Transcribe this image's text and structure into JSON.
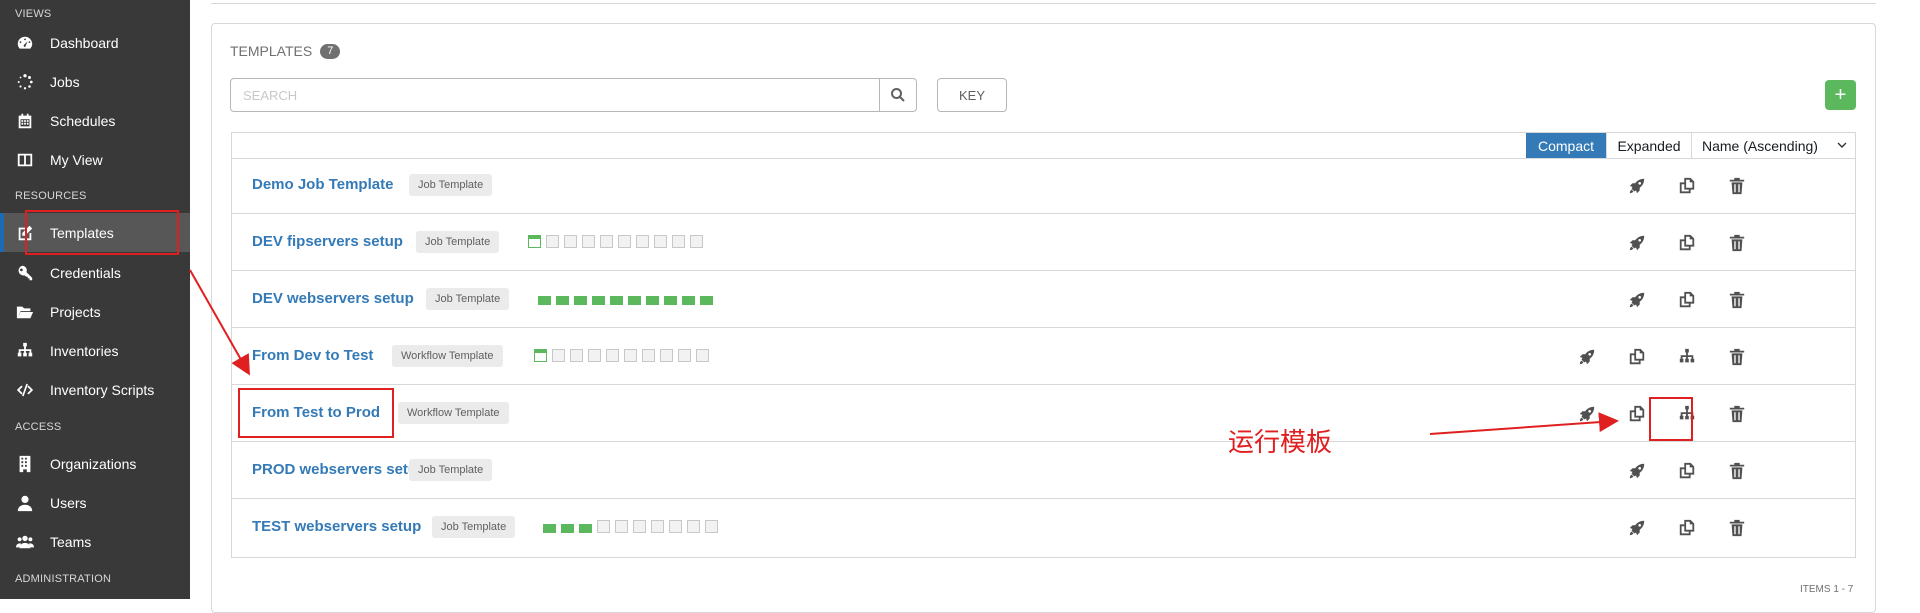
{
  "sidebar": {
    "sections": {
      "views": "VIEWS",
      "resources": "RESOURCES",
      "access": "ACCESS",
      "administration": "ADMINISTRATION"
    },
    "items": [
      {
        "label": "Dashboard",
        "icon": "dashboard-icon"
      },
      {
        "label": "Jobs",
        "icon": "spinner-icon"
      },
      {
        "label": "Schedules",
        "icon": "calendar-icon"
      },
      {
        "label": "My View",
        "icon": "columns-icon"
      },
      {
        "label": "Templates",
        "icon": "edit-icon",
        "active": true
      },
      {
        "label": "Credentials",
        "icon": "key-icon"
      },
      {
        "label": "Projects",
        "icon": "folder-open-icon"
      },
      {
        "label": "Inventories",
        "icon": "sitemap-icon"
      },
      {
        "label": "Inventory Scripts",
        "icon": "code-icon"
      },
      {
        "label": "Organizations",
        "icon": "building-icon"
      },
      {
        "label": "Users",
        "icon": "user-icon"
      },
      {
        "label": "Teams",
        "icon": "users-icon"
      }
    ]
  },
  "header": {
    "title": "TEMPLATES",
    "count": "7"
  },
  "search": {
    "placeholder": "SEARCH"
  },
  "key_label": "KEY",
  "add_label": "+",
  "view_toggle": {
    "compact": "Compact",
    "expanded": "Expanded",
    "sort": "Name (Ascending)"
  },
  "rows": [
    {
      "name": "Demo Job Template",
      "type": "Job Template",
      "sparkline": [],
      "actions": [
        "launch",
        "copy",
        "delete"
      ]
    },
    {
      "name": "DEV fipservers setup",
      "type": "Job Template",
      "sparkline": [
        "ok",
        "empty",
        "empty",
        "empty",
        "empty",
        "empty",
        "empty",
        "empty",
        "empty",
        "empty"
      ],
      "actions": [
        "launch",
        "copy",
        "delete"
      ]
    },
    {
      "name": "DEV webservers setup",
      "type": "Job Template",
      "sparkline": [
        "ok",
        "ok",
        "ok",
        "ok",
        "ok",
        "ok",
        "ok",
        "ok",
        "ok",
        "ok"
      ],
      "actions": [
        "launch",
        "copy",
        "delete"
      ]
    },
    {
      "name": "From Dev to Test",
      "type": "Workflow Template",
      "sparkline": [
        "ok",
        "empty",
        "empty",
        "empty",
        "empty",
        "empty",
        "empty",
        "empty",
        "empty",
        "empty"
      ],
      "actions": [
        "launch",
        "copy",
        "visualize",
        "delete"
      ]
    },
    {
      "name": "From Test to Prod",
      "type": "Workflow Template",
      "sparkline": [],
      "actions": [
        "launch",
        "copy",
        "visualize",
        "delete"
      ]
    },
    {
      "name": "PROD webservers setup",
      "type": "Job Template",
      "sparkline": [],
      "actions": [
        "launch",
        "copy",
        "delete"
      ]
    },
    {
      "name": "TEST webservers setup",
      "type": "Job Template",
      "sparkline": [
        "ok",
        "ok",
        "ok",
        "empty",
        "empty",
        "empty",
        "empty",
        "empty",
        "empty",
        "empty"
      ],
      "actions": [
        "launch",
        "copy",
        "delete"
      ]
    }
  ],
  "pagination": {
    "items": "ITEMS  1 - 7"
  },
  "annotation": {
    "text": "运行模板",
    "color": "#e02020"
  }
}
